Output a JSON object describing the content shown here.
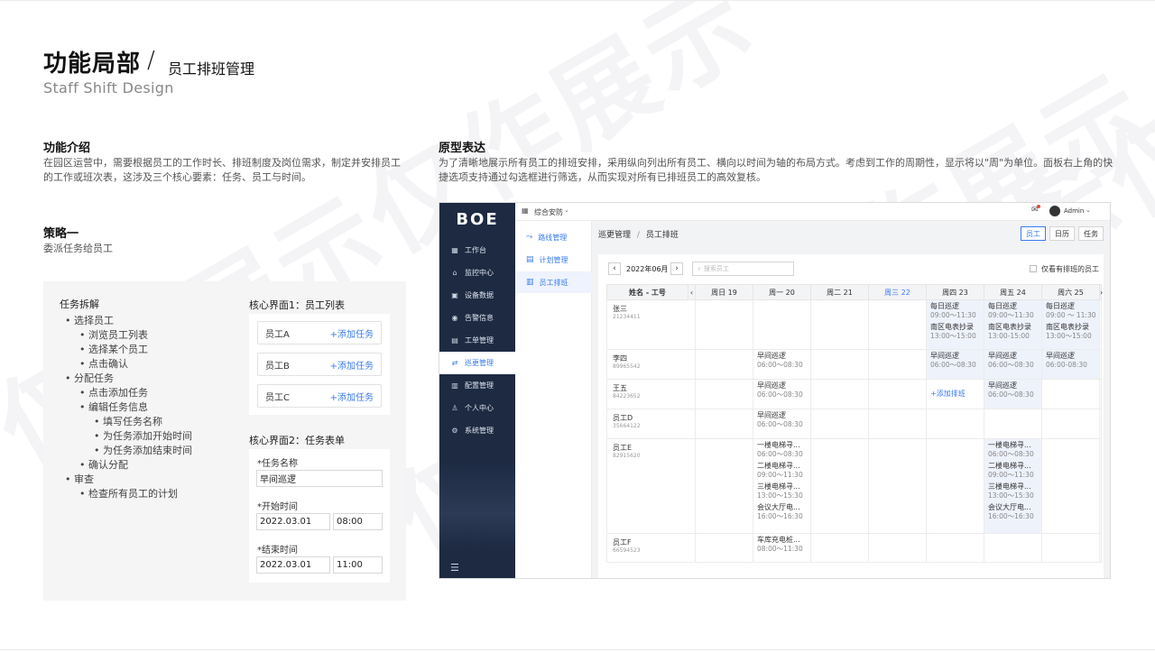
{
  "header": {
    "title": "功能局部",
    "slash": "/",
    "subtitle": "员工排班管理",
    "english": "Staff Shift Design"
  },
  "watermark": "仅作展示仅作展示",
  "intro": {
    "title": "功能介绍",
    "text": "在园区运营中，需要根据员工的工作时长、排班制度及岗位需求，制定并安排员工的工作或班次表，这涉及三个核心要素：任务、员工与时间。"
  },
  "strategy": {
    "title": "策略一",
    "text": "委派任务给员工"
  },
  "prototype": {
    "title": "原型表达",
    "text": "为了清晰地展示所有员工的排班安排，采用纵向列出所有员工、横向以时间为轴的布局方式。考虑到工作的周期性，显示将以\"周\"为单位。面板右上角的快捷选项支持通过勾选框进行筛选，从而实现对所有已排班员工的高效复核。"
  },
  "task_tree": {
    "title": "任务拆解",
    "items": [
      {
        "level": 1,
        "text": "选择员工"
      },
      {
        "level": 2,
        "text": "浏览员工列表"
      },
      {
        "level": 2,
        "text": "选择某个员工"
      },
      {
        "level": 2,
        "text": "点击确认"
      },
      {
        "level": 1,
        "text": "分配任务"
      },
      {
        "level": 2,
        "text": "点击添加任务"
      },
      {
        "level": 2,
        "text": "编辑任务信息"
      },
      {
        "level": 3,
        "text": "填写任务名称"
      },
      {
        "level": 3,
        "text": "为任务添加开始时间"
      },
      {
        "level": 3,
        "text": "为任务添加结束时间"
      },
      {
        "level": 2,
        "text": "确认分配"
      },
      {
        "level": 1,
        "text": "审查"
      },
      {
        "level": 2,
        "text": "检查所有员工的计划"
      }
    ]
  },
  "ui1": {
    "title": "核心界面1：员工列表",
    "rows": [
      {
        "name": "员工A",
        "action": "+添加任务"
      },
      {
        "name": "员工B",
        "action": "+添加任务"
      },
      {
        "name": "员工C",
        "action": "+添加任务"
      }
    ]
  },
  "ui2": {
    "title": "核心界面2：任务表单",
    "name_label": "*任务名称",
    "name_value": "早间巡逻",
    "start_label": "*开始时间",
    "start_date": "2022.03.01",
    "start_time": "08:00",
    "end_label": "*结束时间",
    "end_date": "2022.03.01",
    "end_time": "11:00"
  },
  "app": {
    "logo": "BOE",
    "sidebar": [
      "工作台",
      "监控中心",
      "设备数据",
      "告警信息",
      "工单管理",
      "巡更管理",
      "配置管理",
      "个人中心",
      "系统管理"
    ],
    "sidebar_icons": [
      "▦",
      "⌂",
      "▣",
      "◉",
      "▤",
      "⇄",
      "▥",
      "♙",
      "⚙"
    ],
    "menu_icon": "☰",
    "top": {
      "switcher": "综合安防",
      "user": "Admin"
    },
    "subnav": [
      "路线管理",
      "计划管理",
      "员工排班"
    ],
    "subnav_icons": [
      "⤳",
      "▤",
      "▥"
    ],
    "breadcrumb": {
      "parent": "巡更管理",
      "sep": "/",
      "current": "员工排班"
    },
    "view_tabs": [
      "员工",
      "日历",
      "任务"
    ],
    "month": "2022年06月",
    "search_placeholder": "搜索员工",
    "filter_label": "仅看有排班的员工",
    "table": {
      "name_header": "姓名 - 工号",
      "days": [
        "周日 19",
        "周一 20",
        "周二 21",
        "周三 22",
        "周四 23",
        "周五 24",
        "周六 25"
      ],
      "rows": [
        {
          "name": "张三",
          "id": "21234411",
          "cells": [
            [],
            [],
            [],
            [],
            [
              {
                "t": "每日巡逻",
                "s": "09:00～11:30"
              },
              {
                "t": "南区电表抄录",
                "s": "13:00～15:00"
              }
            ],
            [
              {
                "t": "每日巡逻",
                "s": "09:00～11:30"
              },
              {
                "t": "南区电表抄录",
                "s": "13:00-15:00"
              }
            ],
            [
              {
                "t": "每日巡逻",
                "s": "09:00 ～ 11:30"
              },
              {
                "t": "南区电表抄录",
                "s": "13:00～15:00"
              }
            ]
          ]
        },
        {
          "name": "李四",
          "id": "89965542",
          "cells": [
            [],
            [
              {
                "t": "早间巡逻",
                "s": "06:00～08:30"
              }
            ],
            [],
            [],
            [
              {
                "t": "早间巡逻",
                "s": "06:00～08:30"
              }
            ],
            [
              {
                "t": "早间巡逻",
                "s": "06:00～08:30"
              }
            ],
            [
              {
                "t": "早间巡逻",
                "s": "06:00-08:30"
              }
            ]
          ]
        },
        {
          "name": "王五",
          "id": "84223652",
          "cells": [
            [],
            [
              {
                "t": "早间巡逻",
                "s": "06:00～08:30"
              }
            ],
            [],
            [],
            [],
            [
              {
                "t": "早间巡逻",
                "s": "06:00～08:30"
              }
            ],
            []
          ],
          "add_link": "+添加排班"
        },
        {
          "name": "员工D",
          "id": "35664122",
          "cells": [
            [],
            [
              {
                "t": "早间巡逻",
                "s": "06:00～08:30"
              }
            ],
            [],
            [],
            [],
            [],
            []
          ]
        },
        {
          "name": "员工E",
          "id": "82915620",
          "cells": [
            [],
            [
              {
                "t": "一楼电梯寻...",
                "s": "06:00～08:30"
              },
              {
                "t": "二楼电梯寻...",
                "s": "09:00～11:30"
              },
              {
                "t": "三楼电梯寻...",
                "s": "13:00～15:30"
              },
              {
                "t": "会议大厅电...",
                "s": "16:00～16:30"
              }
            ],
            [],
            [],
            [],
            [
              {
                "t": "一楼电梯寻...",
                "s": "06:00～08:30"
              },
              {
                "t": "二楼电梯寻...",
                "s": "09:00～11:30"
              },
              {
                "t": "三楼电梯寻...",
                "s": "13:00～15:30"
              },
              {
                "t": "会议大厅电...",
                "s": "16:00～16:30"
              }
            ],
            []
          ]
        },
        {
          "name": "员工F",
          "id": "66594523",
          "cells": [
            [],
            [
              {
                "t": "车库充电桩...",
                "s": "08:00～11:30"
              }
            ],
            [],
            [],
            [],
            [],
            []
          ]
        }
      ]
    }
  }
}
